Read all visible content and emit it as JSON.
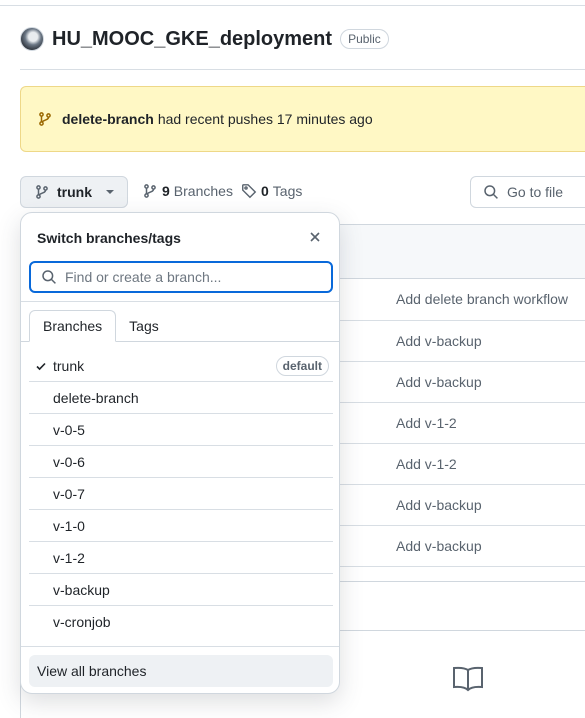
{
  "repo": {
    "name": "HU_MOOC_GKE_deployment",
    "visibility": "Public"
  },
  "flash": {
    "branch": "delete-branch",
    "message": "had recent pushes 17 minutes ago"
  },
  "toolbar": {
    "current_branch": "trunk",
    "branches_count": "9",
    "branches_label": "Branches",
    "tags_count": "0",
    "tags_label": "Tags",
    "goto_file": "Go to file"
  },
  "commits": [
    "Add delete branch workflow",
    "Add v-backup",
    "Add v-backup",
    "Add v-1-2",
    "Add v-1-2",
    "Add v-backup",
    "Add v-backup"
  ],
  "popup": {
    "title": "Switch branches/tags",
    "search_placeholder": "Find or create a branch...",
    "tabs": [
      "Branches",
      "Tags"
    ],
    "branches": [
      {
        "name": "trunk",
        "selected": true,
        "badge": "default"
      },
      {
        "name": "delete-branch"
      },
      {
        "name": "v-0-5"
      },
      {
        "name": "v-0-6"
      },
      {
        "name": "v-0-7"
      },
      {
        "name": "v-1-0"
      },
      {
        "name": "v-1-2"
      },
      {
        "name": "v-backup"
      },
      {
        "name": "v-cronjob"
      }
    ],
    "view_all": "View all branches"
  },
  "colors": {
    "accent": "#0969da",
    "flash_bg": "#fff8c5",
    "muted": "#59636e"
  }
}
